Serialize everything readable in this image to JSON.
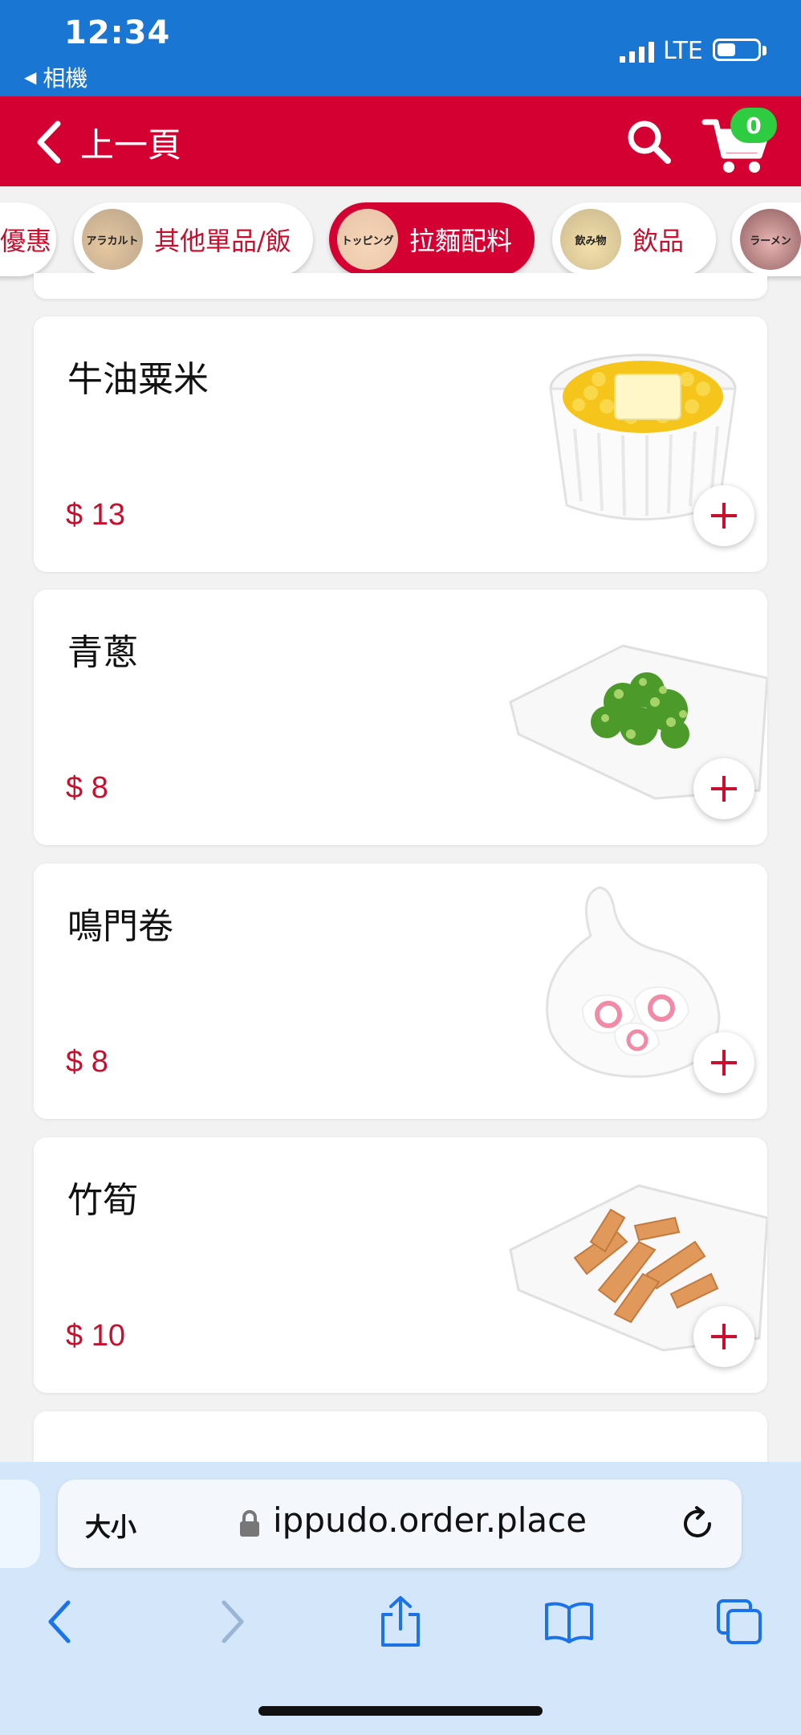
{
  "status": {
    "time": "12:34",
    "back_app": "相機",
    "network": "LTE",
    "battery_level": 0.45
  },
  "header": {
    "back_label": "上一頁",
    "cart_count": "0"
  },
  "categories": [
    {
      "label": "優惠",
      "img_text": ""
    },
    {
      "label": "其他單品/飯",
      "img_text": "アラカルト"
    },
    {
      "label": "拉麵配料",
      "img_text": "トッピング",
      "active": true
    },
    {
      "label": "飲品",
      "img_text": "飲み物"
    },
    {
      "label": "",
      "img_text": "ラーメン"
    }
  ],
  "items": [
    {
      "name": "牛油粟米",
      "price": "$ 13"
    },
    {
      "name": "青蔥",
      "price": "$ 8"
    },
    {
      "name": "鳴門卷",
      "price": "$ 8"
    },
    {
      "name": "竹筍",
      "price": "$ 10"
    },
    {
      "name": "",
      "price": ""
    }
  ],
  "safari": {
    "text_size": "大小",
    "url": "ippudo.order.place"
  },
  "colors": {
    "status_blue": "#1976d2",
    "brand_red": "#d50032",
    "price_red": "#c8102e",
    "badge_green": "#2ecc40"
  }
}
